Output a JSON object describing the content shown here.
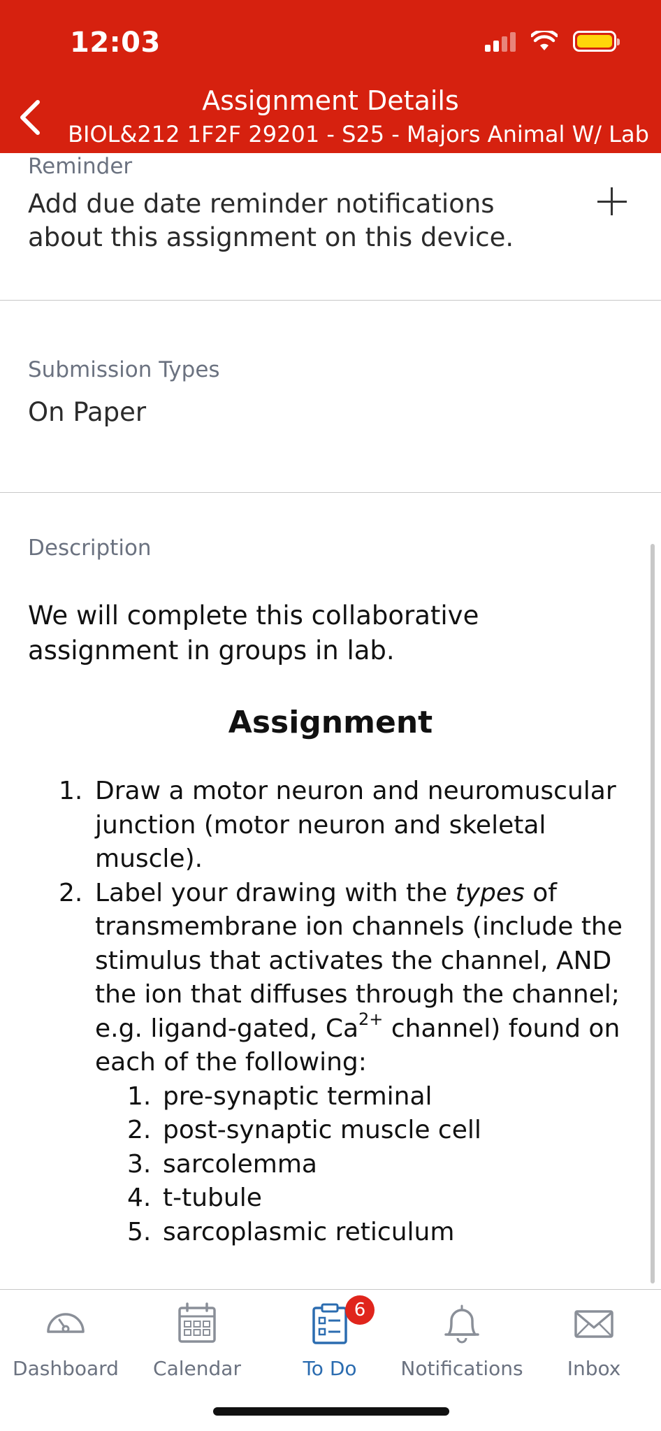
{
  "status_bar": {
    "time": "12:03"
  },
  "nav": {
    "title": "Assignment Details",
    "subtitle": "BIOL&212 1F2F 29201 - S25 - Majors Animal W/ Lab"
  },
  "reminder": {
    "label": "Reminder",
    "text": "Add due date reminder notifications about this assignment on this device."
  },
  "submission_types": {
    "label": "Submission Types",
    "value": "On Paper"
  },
  "description": {
    "label": "Description",
    "intro": "We will complete this collaborative assignment in groups in lab.",
    "heading": "Assignment",
    "items": [
      {
        "num": "1.",
        "text": "Draw a motor neuron and neuromuscular junction (motor neuron and skeletal muscle)."
      },
      {
        "num": "2.",
        "text_a": "Label your drawing with the ",
        "text_b": "types",
        "text_c": " of transmembrane ion channels (include the stimulus that activates the channel, AND the ion that diffuses through the channel; e.g. ligand-gated, Ca",
        "text_sup": "2+",
        "text_d": " channel) found on each of the following:",
        "subitems": [
          {
            "num": "1.",
            "text": "pre-synaptic terminal"
          },
          {
            "num": "2.",
            "text": "post-synaptic muscle cell"
          },
          {
            "num": "3.",
            "text": "sarcolemma"
          },
          {
            "num": "4.",
            "text": "t-tubule"
          },
          {
            "num": "5.",
            "text": "sarcoplasmic reticulum"
          }
        ]
      }
    ]
  },
  "tabbar": {
    "tabs": [
      {
        "label": "Dashboard",
        "icon": "dashboard-icon"
      },
      {
        "label": "Calendar",
        "icon": "calendar-icon"
      },
      {
        "label": "To Do",
        "icon": "todo-icon",
        "badge": "6"
      },
      {
        "label": "Notifications",
        "icon": "bell-icon"
      },
      {
        "label": "Inbox",
        "icon": "mail-icon"
      }
    ]
  },
  "colors": {
    "header": "#d6210f",
    "active_tab": "#2b6cb0",
    "badge": "#e0251c",
    "battery": "#ffd60a"
  }
}
